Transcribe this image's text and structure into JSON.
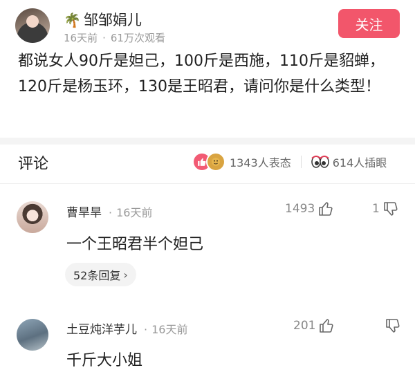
{
  "post": {
    "author": "邹邹娟儿",
    "author_icon": "palm-tree-icon",
    "time": "16天前",
    "views": "61万次观看",
    "follow_label": "关注",
    "text": "都说女人90斤是妲己，100斤是西施，110斤是貂蝉，120斤是杨玉环，130是王昭君，请问你是什么类型！",
    "accent_color": "#f2566b"
  },
  "comments_header": {
    "title": "评论",
    "reactions_text": "1343人表态",
    "watchers_text": "614人插眼"
  },
  "comments": [
    {
      "user": "曹旱旱",
      "time": "16天前",
      "text": "一个王昭君半个妲己",
      "likes": "1493",
      "dislikes": "1",
      "replies_label": "52条回复"
    },
    {
      "user": "土豆炖洋芋儿",
      "time": "16天前",
      "text": "千斤大小姐",
      "likes": "201",
      "dislikes": ""
    }
  ]
}
